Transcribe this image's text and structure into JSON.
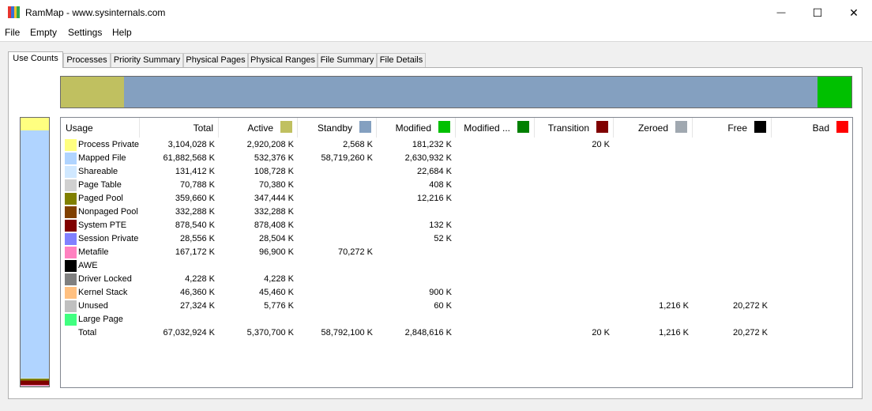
{
  "window": {
    "title": "RamMap - www.sysinternals.com",
    "minimize_glyph": "—",
    "maximize_glyph": "☐",
    "close_glyph": "✕",
    "icon_colors": [
      "#e8352e",
      "#3a6fd8",
      "#f5c32c",
      "#2fa84f"
    ]
  },
  "menu": [
    "File",
    "Empty",
    "Settings",
    "Help"
  ],
  "tabs": [
    "Use Counts",
    "Processes",
    "Priority Summary",
    "Physical Pages",
    "Physical Ranges",
    "File Summary",
    "File Details"
  ],
  "active_tab": 0,
  "overview_bar": [
    {
      "color": "#c0c060",
      "fraction": 0.08
    },
    {
      "color": "#84a0c0",
      "fraction": 0.877
    },
    {
      "color": "#00c000",
      "fraction": 0.043
    }
  ],
  "usage_bar": [
    {
      "color": "#ffff80",
      "fraction": 0.046
    },
    {
      "color": "#b0d4ff",
      "fraction": 0.923
    },
    {
      "color": "#d0e8ff",
      "fraction": 0.002
    },
    {
      "color": "#808000",
      "fraction": 0.005
    },
    {
      "color": "#804000",
      "fraction": 0.005
    },
    {
      "color": "#800000",
      "fraction": 0.013
    },
    {
      "color": "#ff80c0",
      "fraction": 0.003
    },
    {
      "color": "#c0c0c0",
      "fraction": 0.003
    }
  ],
  "columns": [
    {
      "label": "Usage",
      "color": null
    },
    {
      "label": "Total",
      "color": null
    },
    {
      "label": "Active",
      "color": "#c0c060"
    },
    {
      "label": "Standby",
      "color": "#84a0c0"
    },
    {
      "label": "Modified",
      "color": "#00c000"
    },
    {
      "label": "Modified ...",
      "color": "#008000"
    },
    {
      "label": "Transition",
      "color": "#800000"
    },
    {
      "label": "Zeroed",
      "color": "#a0a8b0"
    },
    {
      "label": "Free",
      "color": "#000000"
    },
    {
      "label": "Bad",
      "color": "#ff0000"
    }
  ],
  "rows": [
    {
      "color": "#ffff80",
      "cells": [
        "Process Private",
        "3,104,028 K",
        "2,920,208 K",
        "2,568 K",
        "181,232 K",
        "",
        "20 K",
        "",
        "",
        ""
      ]
    },
    {
      "color": "#b0d4ff",
      "cells": [
        "Mapped File",
        "61,882,568 K",
        "532,376 K",
        "58,719,260 K",
        "2,630,932 K",
        "",
        "",
        "",
        "",
        ""
      ]
    },
    {
      "color": "#d0e8ff",
      "cells": [
        "Shareable",
        "131,412 K",
        "108,728 K",
        "",
        "22,684 K",
        "",
        "",
        "",
        "",
        ""
      ]
    },
    {
      "color": "#d0d0d0",
      "cells": [
        "Page Table",
        "70,788 K",
        "70,380 K",
        "",
        "408 K",
        "",
        "",
        "",
        "",
        ""
      ]
    },
    {
      "color": "#808000",
      "cells": [
        "Paged Pool",
        "359,660 K",
        "347,444 K",
        "",
        "12,216 K",
        "",
        "",
        "",
        "",
        ""
      ]
    },
    {
      "color": "#804000",
      "cells": [
        "Nonpaged Pool",
        "332,288 K",
        "332,288 K",
        "",
        "",
        "",
        "",
        "",
        "",
        ""
      ]
    },
    {
      "color": "#800000",
      "cells": [
        "System PTE",
        "878,540 K",
        "878,408 K",
        "",
        "132 K",
        "",
        "",
        "",
        "",
        ""
      ]
    },
    {
      "color": "#8080ff",
      "cells": [
        "Session Private",
        "28,556 K",
        "28,504 K",
        "",
        "52 K",
        "",
        "",
        "",
        "",
        ""
      ]
    },
    {
      "color": "#ff80c0",
      "cells": [
        "Metafile",
        "167,172 K",
        "96,900 K",
        "70,272 K",
        "",
        "",
        "",
        "",
        "",
        ""
      ]
    },
    {
      "color": "#000000",
      "cells": [
        "AWE",
        "",
        "",
        "",
        "",
        "",
        "",
        "",
        "",
        ""
      ]
    },
    {
      "color": "#808080",
      "cells": [
        "Driver Locked",
        "4,228 K",
        "4,228 K",
        "",
        "",
        "",
        "",
        "",
        "",
        ""
      ]
    },
    {
      "color": "#ffc080",
      "cells": [
        "Kernel Stack",
        "46,360 K",
        "45,460 K",
        "",
        "900 K",
        "",
        "",
        "",
        "",
        ""
      ]
    },
    {
      "color": "#c0c0c0",
      "cells": [
        "Unused",
        "27,324 K",
        "5,776 K",
        "",
        "60 K",
        "",
        "",
        "1,216 K",
        "20,272 K",
        ""
      ]
    },
    {
      "color": "#40ff80",
      "cells": [
        "Large Page",
        "",
        "",
        "",
        "",
        "",
        "",
        "",
        "",
        ""
      ]
    },
    {
      "color": null,
      "cells": [
        "Total",
        "67,032,924 K",
        "5,370,700 K",
        "58,792,100 K",
        "2,848,616 K",
        "",
        "20 K",
        "1,216 K",
        "20,272 K",
        ""
      ]
    }
  ]
}
